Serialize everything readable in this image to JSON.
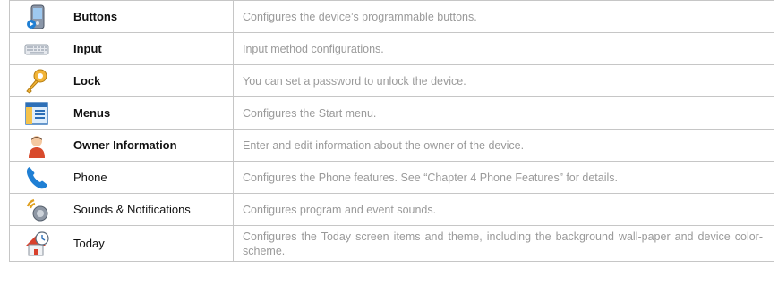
{
  "rows": [
    {
      "icon": "phone-device-icon",
      "name": "Buttons",
      "desc": "Configures the device’s programmable buttons."
    },
    {
      "icon": "keyboard-icon",
      "name": "Input",
      "desc": "Input method configurations."
    },
    {
      "icon": "key-icon",
      "name": "Lock",
      "desc": "You can set a password to unlock the device."
    },
    {
      "icon": "window-menu-icon",
      "name": "Menus",
      "desc": "Configures the Start menu."
    },
    {
      "icon": "person-icon",
      "name": "Owner Information",
      "desc": "Enter and edit information about the owner of the device."
    },
    {
      "icon": "handset-icon",
      "name": "Phone",
      "desc": "Configures the Phone features. See “Chapter 4 Phone Features” for details."
    },
    {
      "icon": "speaker-sound-icon",
      "name": "Sounds & Notifications",
      "desc": "Configures program and event sounds."
    },
    {
      "icon": "house-clock-icon",
      "name": "Today",
      "desc": "Configures the Today screen items and theme, including the background wall-paper and device color-scheme."
    }
  ]
}
